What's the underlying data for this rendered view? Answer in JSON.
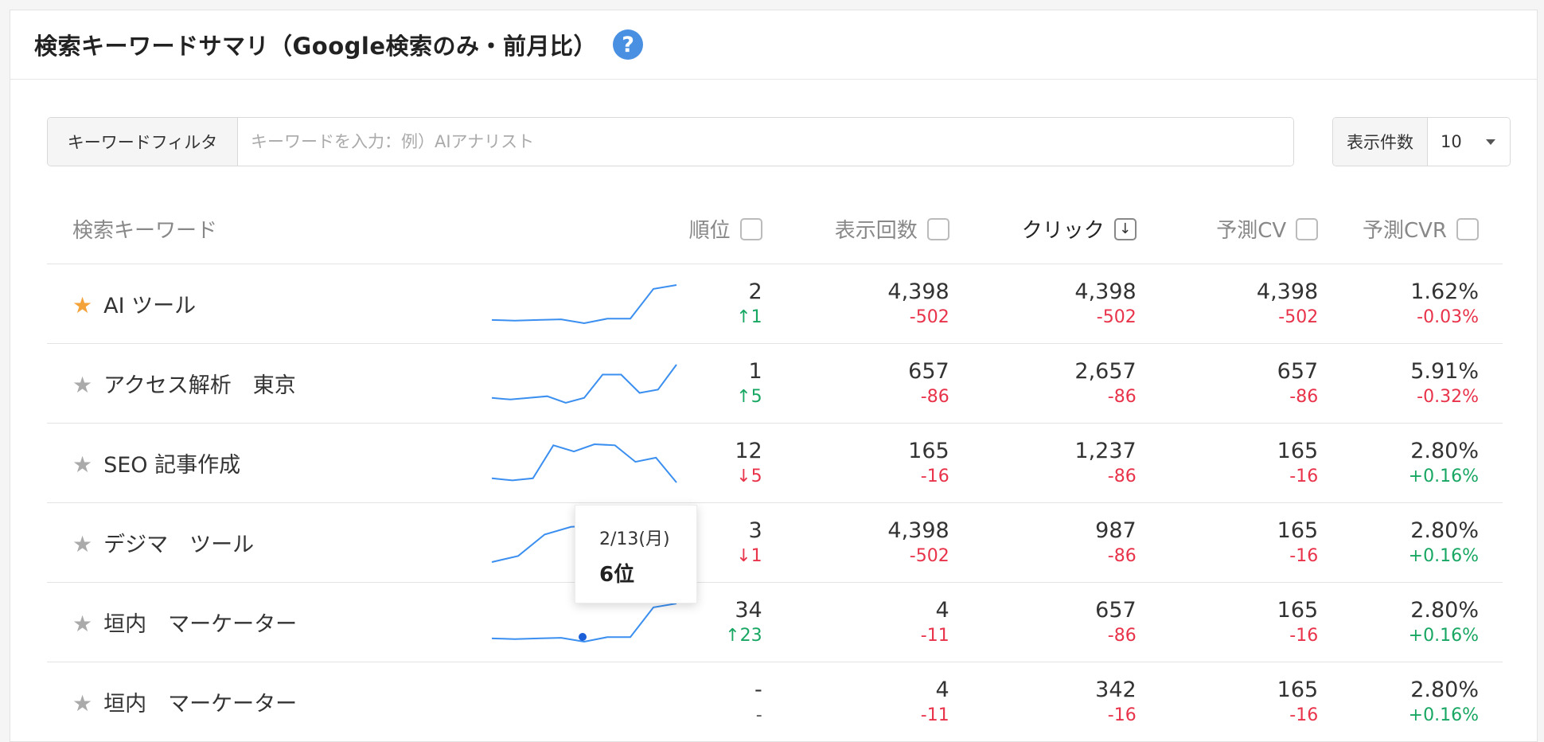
{
  "card": {
    "title": "検索キーワードサマリ（Google検索のみ・前月比）",
    "help_icon": "question-circle-icon"
  },
  "filter": {
    "label": "キーワードフィルタ",
    "placeholder": "キーワードを入力：例）AIアナリスト",
    "value": ""
  },
  "display_count": {
    "label": "表示件数",
    "selected": "10"
  },
  "table": {
    "headers": {
      "keyword": "検索キーワード",
      "rank": "順位",
      "impressions": "表示回数",
      "clicks": "クリック",
      "cv": "予測CV",
      "cvr": "予測CVR"
    },
    "sorted_by": "clicks",
    "rows": [
      {
        "keyword": "AI ツール",
        "favorite": true,
        "spark": [
          4,
          3.5,
          4,
          4.5,
          1.5,
          5,
          5,
          28,
          31
        ],
        "rank": "2",
        "rank_delta": "↑1",
        "rank_dir": "up",
        "impressions": "4,398",
        "impressions_delta": "-502",
        "clicks": "4,398",
        "clicks_delta": "-502",
        "cv": "4,398",
        "cv_delta": "-502",
        "cvr": "1.62%",
        "cvr_delta": "-0.03%"
      },
      {
        "keyword": "アクセス解析　東京",
        "favorite": false,
        "spark": [
          8,
          7,
          8,
          9,
          5,
          8,
          22,
          22,
          11,
          13,
          28
        ],
        "rank": "1",
        "rank_delta": "↑5",
        "rank_dir": "up",
        "impressions": "657",
        "impressions_delta": "-86",
        "clicks": "2,657",
        "clicks_delta": "-86",
        "cv": "657",
        "cv_delta": "-86",
        "cvr": "5.91%",
        "cvr_delta": "-0.32%"
      },
      {
        "keyword": "SEO 記事作成",
        "favorite": false,
        "spark": [
          6,
          4,
          6,
          38,
          32,
          39,
          38,
          22,
          26,
          2
        ],
        "rank": "12",
        "rank_delta": "↓5",
        "rank_dir": "down",
        "impressions": "165",
        "impressions_delta": "-16",
        "clicks": "1,237",
        "clicks_delta": "-86",
        "cv": "165",
        "cv_delta": "-16",
        "cvr": "2.80%",
        "cvr_delta": "+0.16%"
      },
      {
        "keyword": "デジマ　ツール",
        "favorite": false,
        "spark": [
          2,
          6,
          20,
          25,
          26,
          27,
          26,
          25
        ],
        "rank": "3",
        "rank_delta": "↓1",
        "rank_dir": "down",
        "impressions": "4,398",
        "impressions_delta": "-502",
        "clicks": "987",
        "clicks_delta": "-86",
        "cv": "165",
        "cv_delta": "-16",
        "cvr": "2.80%",
        "cvr_delta": "+0.16%"
      },
      {
        "keyword": "垣内　マーケーター",
        "favorite": false,
        "spark": [
          4,
          3.5,
          4,
          4.5,
          1.5,
          5,
          5,
          28,
          31
        ],
        "rank": "34",
        "rank_delta": "↑23",
        "rank_dir": "up",
        "impressions": "4",
        "impressions_delta": "-11",
        "clicks": "657",
        "clicks_delta": "-86",
        "cv": "165",
        "cv_delta": "-16",
        "cvr": "2.80%",
        "cvr_delta": "+0.16%"
      },
      {
        "keyword": "垣内　マーケーター",
        "favorite": false,
        "spark": [],
        "rank": "-",
        "rank_delta": "-",
        "rank_dir": "none",
        "impressions": "4",
        "impressions_delta": "-11",
        "clicks": "342",
        "clicks_delta": "-16",
        "cv": "165",
        "cv_delta": "-16",
        "cvr": "2.80%",
        "cvr_delta": "+0.16%"
      }
    ]
  },
  "tooltip": {
    "date": "2/13(月)",
    "rank": "6位"
  },
  "colors": {
    "accent": "#4a90e2",
    "sparkline": "#3b8ff0",
    "favorite_star": "#f4a23a",
    "negative": "#e8334a",
    "positive": "#18a763"
  }
}
